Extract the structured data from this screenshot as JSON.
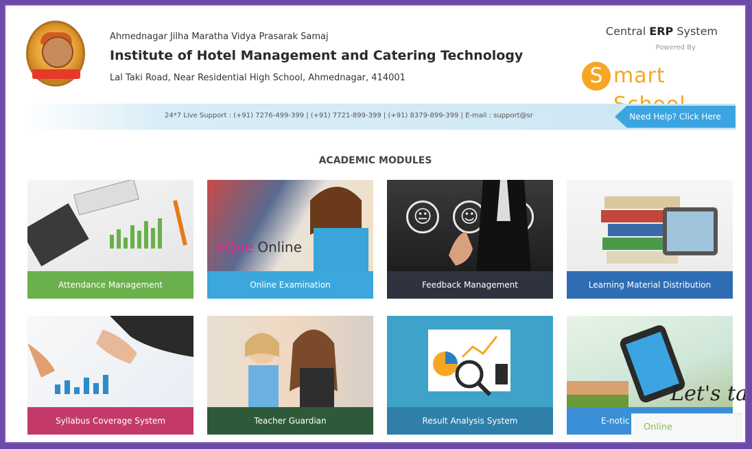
{
  "header": {
    "org": "Ahmednagar Jilha Maratha Vidya Prasarak Samaj",
    "institute": "Institute of Hotel Management and Catering Technology",
    "address": "Lal Taki Road, Near Residential High School, Ahmednagar, 414001",
    "erp_prefix": "Central ",
    "erp_bold": "ERP",
    "erp_suffix": " System",
    "powered_by": "Powered By",
    "brand_s": "S",
    "brand_rest": "mart School"
  },
  "support": {
    "text": "24*7 Live Support : (+91) 7276-499-399 | (+91) 7721-899-399 | (+91) 8379-899-399 | E-mail : support@sr",
    "help_button": "Need Help? Click Here"
  },
  "section_title": "ACADEMIC MODULES",
  "modules": [
    {
      "label": "Attendance Management",
      "color": "#6ab04c"
    },
    {
      "label": "Online Examination",
      "color": "#3ba7dc",
      "overlay_prefix": "eQue",
      "overlay_suffix": " Online"
    },
    {
      "label": "Feedback Management",
      "color": "#2f3340"
    },
    {
      "label": "Learning Material Distribution",
      "color": "#2e6db4"
    },
    {
      "label": "Syllabus Coverage System",
      "color": "#c33a6a"
    },
    {
      "label": "Teacher Guardian",
      "color": "#2f5a3a"
    },
    {
      "label": "Result Analysis System",
      "color": "#2f7fa8"
    },
    {
      "label": "E-notic",
      "color": "#3a8fd6"
    }
  ],
  "chat": {
    "lets": "Let's ta",
    "status": "Online"
  },
  "colors": {
    "accent": "#3aa5e0",
    "brand": "#f5a623",
    "frame": "#7a5ab8"
  }
}
